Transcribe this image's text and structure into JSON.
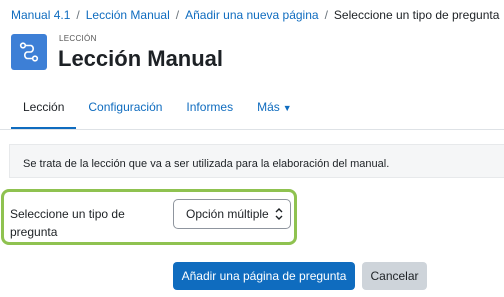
{
  "breadcrumb": {
    "items": [
      "Manual 4.1",
      "Lección Manual",
      "Añadir una nueva página"
    ],
    "current": "Seleccione un tipo de pregunta",
    "separator": "/"
  },
  "header": {
    "kicker": "LECCIÓN",
    "title": "Lección Manual",
    "icon": "lesson-icon"
  },
  "tabs": [
    {
      "label": "Lección",
      "active": true
    },
    {
      "label": "Configuración",
      "active": false
    },
    {
      "label": "Informes",
      "active": false
    },
    {
      "label": "Más",
      "active": false,
      "has_caret": true
    }
  ],
  "description": "Se trata de la lección que va a ser utilizada para la elaboración del manual.",
  "form": {
    "label": "Seleccione un tipo de pregunta",
    "select_value": "Opción múltiple"
  },
  "buttons": {
    "primary": "Añadir una página de pregunta",
    "secondary": "Cancelar"
  },
  "colors": {
    "accent": "#0f6cbf",
    "highlight": "#8fc250",
    "icon_bg": "#3d7fd6"
  }
}
